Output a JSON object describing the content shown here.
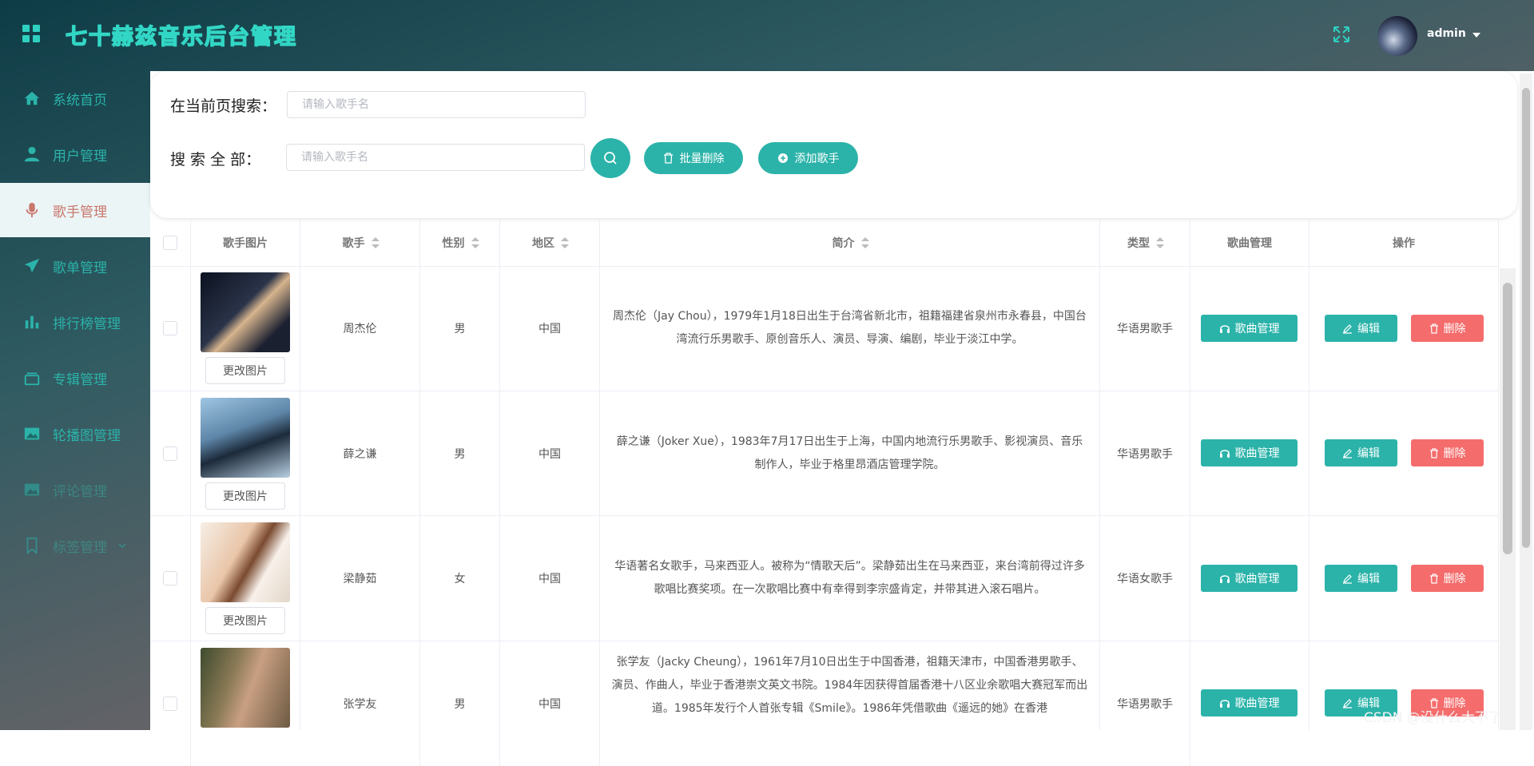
{
  "header": {
    "title": "七十赫兹音乐后台管理",
    "username": "admin"
  },
  "sidebar": {
    "items": [
      {
        "label": "系统首页",
        "icon": "home-icon"
      },
      {
        "label": "用户管理",
        "icon": "user-icon"
      },
      {
        "label": "歌手管理",
        "icon": "microphone-icon"
      },
      {
        "label": "歌单管理",
        "icon": "paper-plane-icon"
      },
      {
        "label": "排行榜管理",
        "icon": "bar-chart-icon"
      },
      {
        "label": "专辑管理",
        "icon": "album-icon"
      },
      {
        "label": "轮播图管理",
        "icon": "picture-icon"
      },
      {
        "label": "评论管理",
        "icon": "picture-icon"
      },
      {
        "label": "标签管理",
        "icon": "bookmark-icon"
      }
    ]
  },
  "search": {
    "page_label": "在当前页搜索：",
    "all_label": "搜 索 全 部：",
    "page_placeholder": "请输入歌手名",
    "all_placeholder": "请输入歌手名",
    "batch_delete": "批量删除",
    "add_singer": "添加歌手"
  },
  "table": {
    "headers": {
      "photo": "歌手图片",
      "singer": "歌手",
      "sex": "性别",
      "region": "地区",
      "intro": "简介",
      "type": "类型",
      "songs": "歌曲管理",
      "ops": "操作"
    },
    "change_photo": "更改图片",
    "song_btn": "歌曲管理",
    "edit_btn": "编辑",
    "delete_btn": "删除",
    "rows": [
      {
        "name": "周杰伦",
        "sex": "男",
        "region": "中国",
        "intro": "周杰伦（Jay Chou），1979年1月18日出生于台湾省新北市，祖籍福建省泉州市永春县，中国台湾流行乐男歌手、原创音乐人、演员、导演、编剧，毕业于淡江中学。",
        "type": "华语男歌手"
      },
      {
        "name": "薛之谦",
        "sex": "男",
        "region": "中国",
        "intro": "薛之谦（Joker Xue），1983年7月17日出生于上海，中国内地流行乐男歌手、影视演员、音乐制作人，毕业于格里昂酒店管理学院。",
        "type": "华语男歌手"
      },
      {
        "name": "梁静茹",
        "sex": "女",
        "region": "中国",
        "intro": "华语著名女歌手，马来西亚人。被称为“情歌天后”。梁静茹出生在马来西亚，来台湾前得过许多歌唱比赛奖项。在一次歌唱比赛中有幸得到李宗盛肯定，并带其进入滚石唱片。",
        "type": "华语女歌手"
      },
      {
        "name": "张学友",
        "sex": "男",
        "region": "中国",
        "intro": "张学友（Jacky Cheung），1961年7月10日出生于中国香港，祖籍天津市，中国香港男歌手、演员、作曲人，毕业于香港崇文英文书院。1984年因获得首届香港十八区业余歌唱大赛冠军而出道。1985年发行个人首张专辑《Smile》。1986年凭借歌曲《遥远的她》在香港",
        "type": "华语男歌手"
      }
    ]
  },
  "watermark": "CSDN @没什么大不了、",
  "colors": {
    "accent": "#2bb3a9",
    "danger": "#f56c6c",
    "active_text": "#c9766c"
  }
}
